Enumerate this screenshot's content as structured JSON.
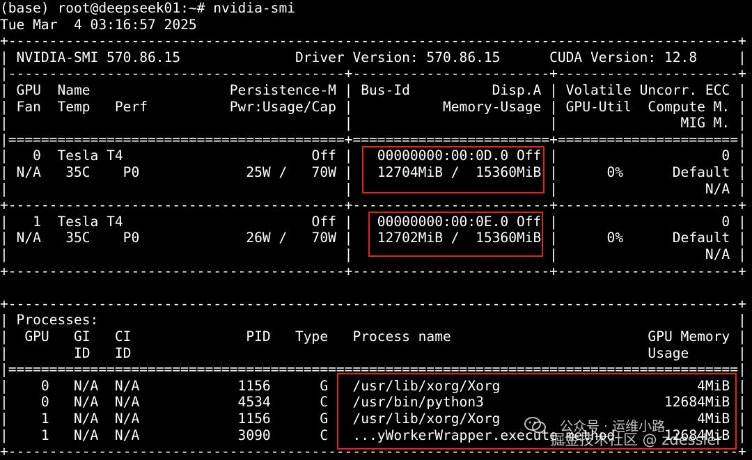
{
  "terminal": {
    "lines": [
      "(base) root@deepseek01:~# nvidia-smi",
      "Tue Mar  4 03:16:57 2025",
      "+-----------------------------------------------------------------------------------------+",
      "| NVIDIA-SMI 570.86.15              Driver Version: 570.86.15      CUDA Version: 12.8     |",
      "|-----------------------------------------+------------------------+----------------------+",
      "| GPU  Name                 Persistence-M | Bus-Id          Disp.A | Volatile Uncorr. ECC |",
      "| Fan  Temp   Perf          Pwr:Usage/Cap |           Memory-Usage | GPU-Util  Compute M. |",
      "|                                         |                        |               MIG M. |",
      "|=========================================+========================+======================|",
      "|   0  Tesla T4                       Off |   00000000:00:0D.0 Off |                    0 |",
      "| N/A   35C    P0             25W /   70W |   12704MiB /  15360MiB |      0%      Default |",
      "|                                         |                        |                  N/A |",
      "+-----------------------------------------+------------------------+----------------------+",
      "|   1  Tesla T4                       Off |   00000000:00:0E.0 Off |                    0 |",
      "| N/A   35C    P0             26W /   70W |   12702MiB /  15360MiB |      0%      Default |",
      "|                                         |                        |                  N/A |",
      "+-----------------------------------------+------------------------+----------------------+",
      "",
      "+-----------------------------------------------------------------------------------------+",
      "| Processes:                                                                              |",
      "|  GPU   GI   CI              PID   Type   Process name                        GPU Memory |",
      "|        ID   ID                                                               Usage      |",
      "|=========================================================================================|",
      "|    0   N/A  N/A            1156      G   /usr/lib/xorg/Xorg                        4MiB |",
      "|    0   N/A  N/A            4534      C   /usr/bin/python3                      12684MiB |",
      "|    1   N/A  N/A            1156      G   /usr/lib/xorg/Xorg                        4MiB |",
      "|    1   N/A  N/A            3090      C   ...yWorkerWrapper.execute_method      12684MiB |",
      "+-----------------------------------------------------------------------------------------+"
    ]
  },
  "watermark": {
    "line1": "公众号 · 运维小路",
    "line2": "掘金技术社区 @ zdessler",
    "icon": "wechat-icon"
  },
  "colors": {
    "background": "#000000",
    "text": "#ffffff",
    "highlight": "#e0251b"
  }
}
